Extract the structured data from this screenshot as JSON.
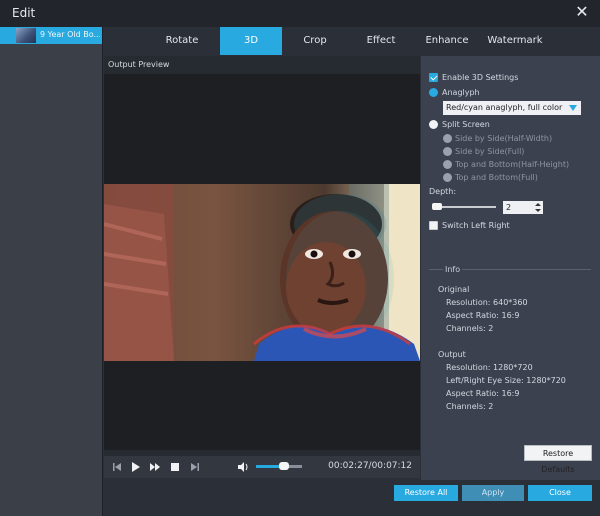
{
  "window": {
    "title": "Edit"
  },
  "sidebar": {
    "file_name": "9 Year Old Bo..."
  },
  "tabs": [
    "Rotate",
    "3D",
    "Crop",
    "Effect",
    "Enhance",
    "Watermark"
  ],
  "active_tab": "3D",
  "preview": {
    "label": "Output Preview",
    "progress_fraction": 0.34
  },
  "player": {
    "time": "00:02:27/00:07:12",
    "volume_fraction": 0.6
  },
  "settings": {
    "enable_3d": "Enable 3D Settings",
    "anaglyph": "Anaglyph",
    "anaglyph_mode": "Red/cyan anaglyph, full color",
    "split_screen": "Split Screen",
    "split_options": [
      "Side by Side(Half-Width)",
      "Side by Side(Full)",
      "Top and Bottom(Half-Height)",
      "Top and Bottom(Full)"
    ],
    "depth_label": "Depth:",
    "depth_value": "2",
    "switch_left_right": "Switch Left Right"
  },
  "info": {
    "title": "Info",
    "original_label": "Original",
    "original": [
      "Resolution: 640*360",
      "Aspect Ratio: 16:9",
      "Channels: 2"
    ],
    "output_label": "Output",
    "output": [
      "Resolution: 1280*720",
      "Left/Right Eye Size: 1280*720",
      "Aspect Ratio: 16:9",
      "Channels: 2"
    ]
  },
  "buttons": {
    "restore_defaults": "Restore Defaults",
    "restore_all": "Restore All",
    "apply": "Apply",
    "close": "Close"
  },
  "colors": {
    "accent": "#28a9e0"
  }
}
